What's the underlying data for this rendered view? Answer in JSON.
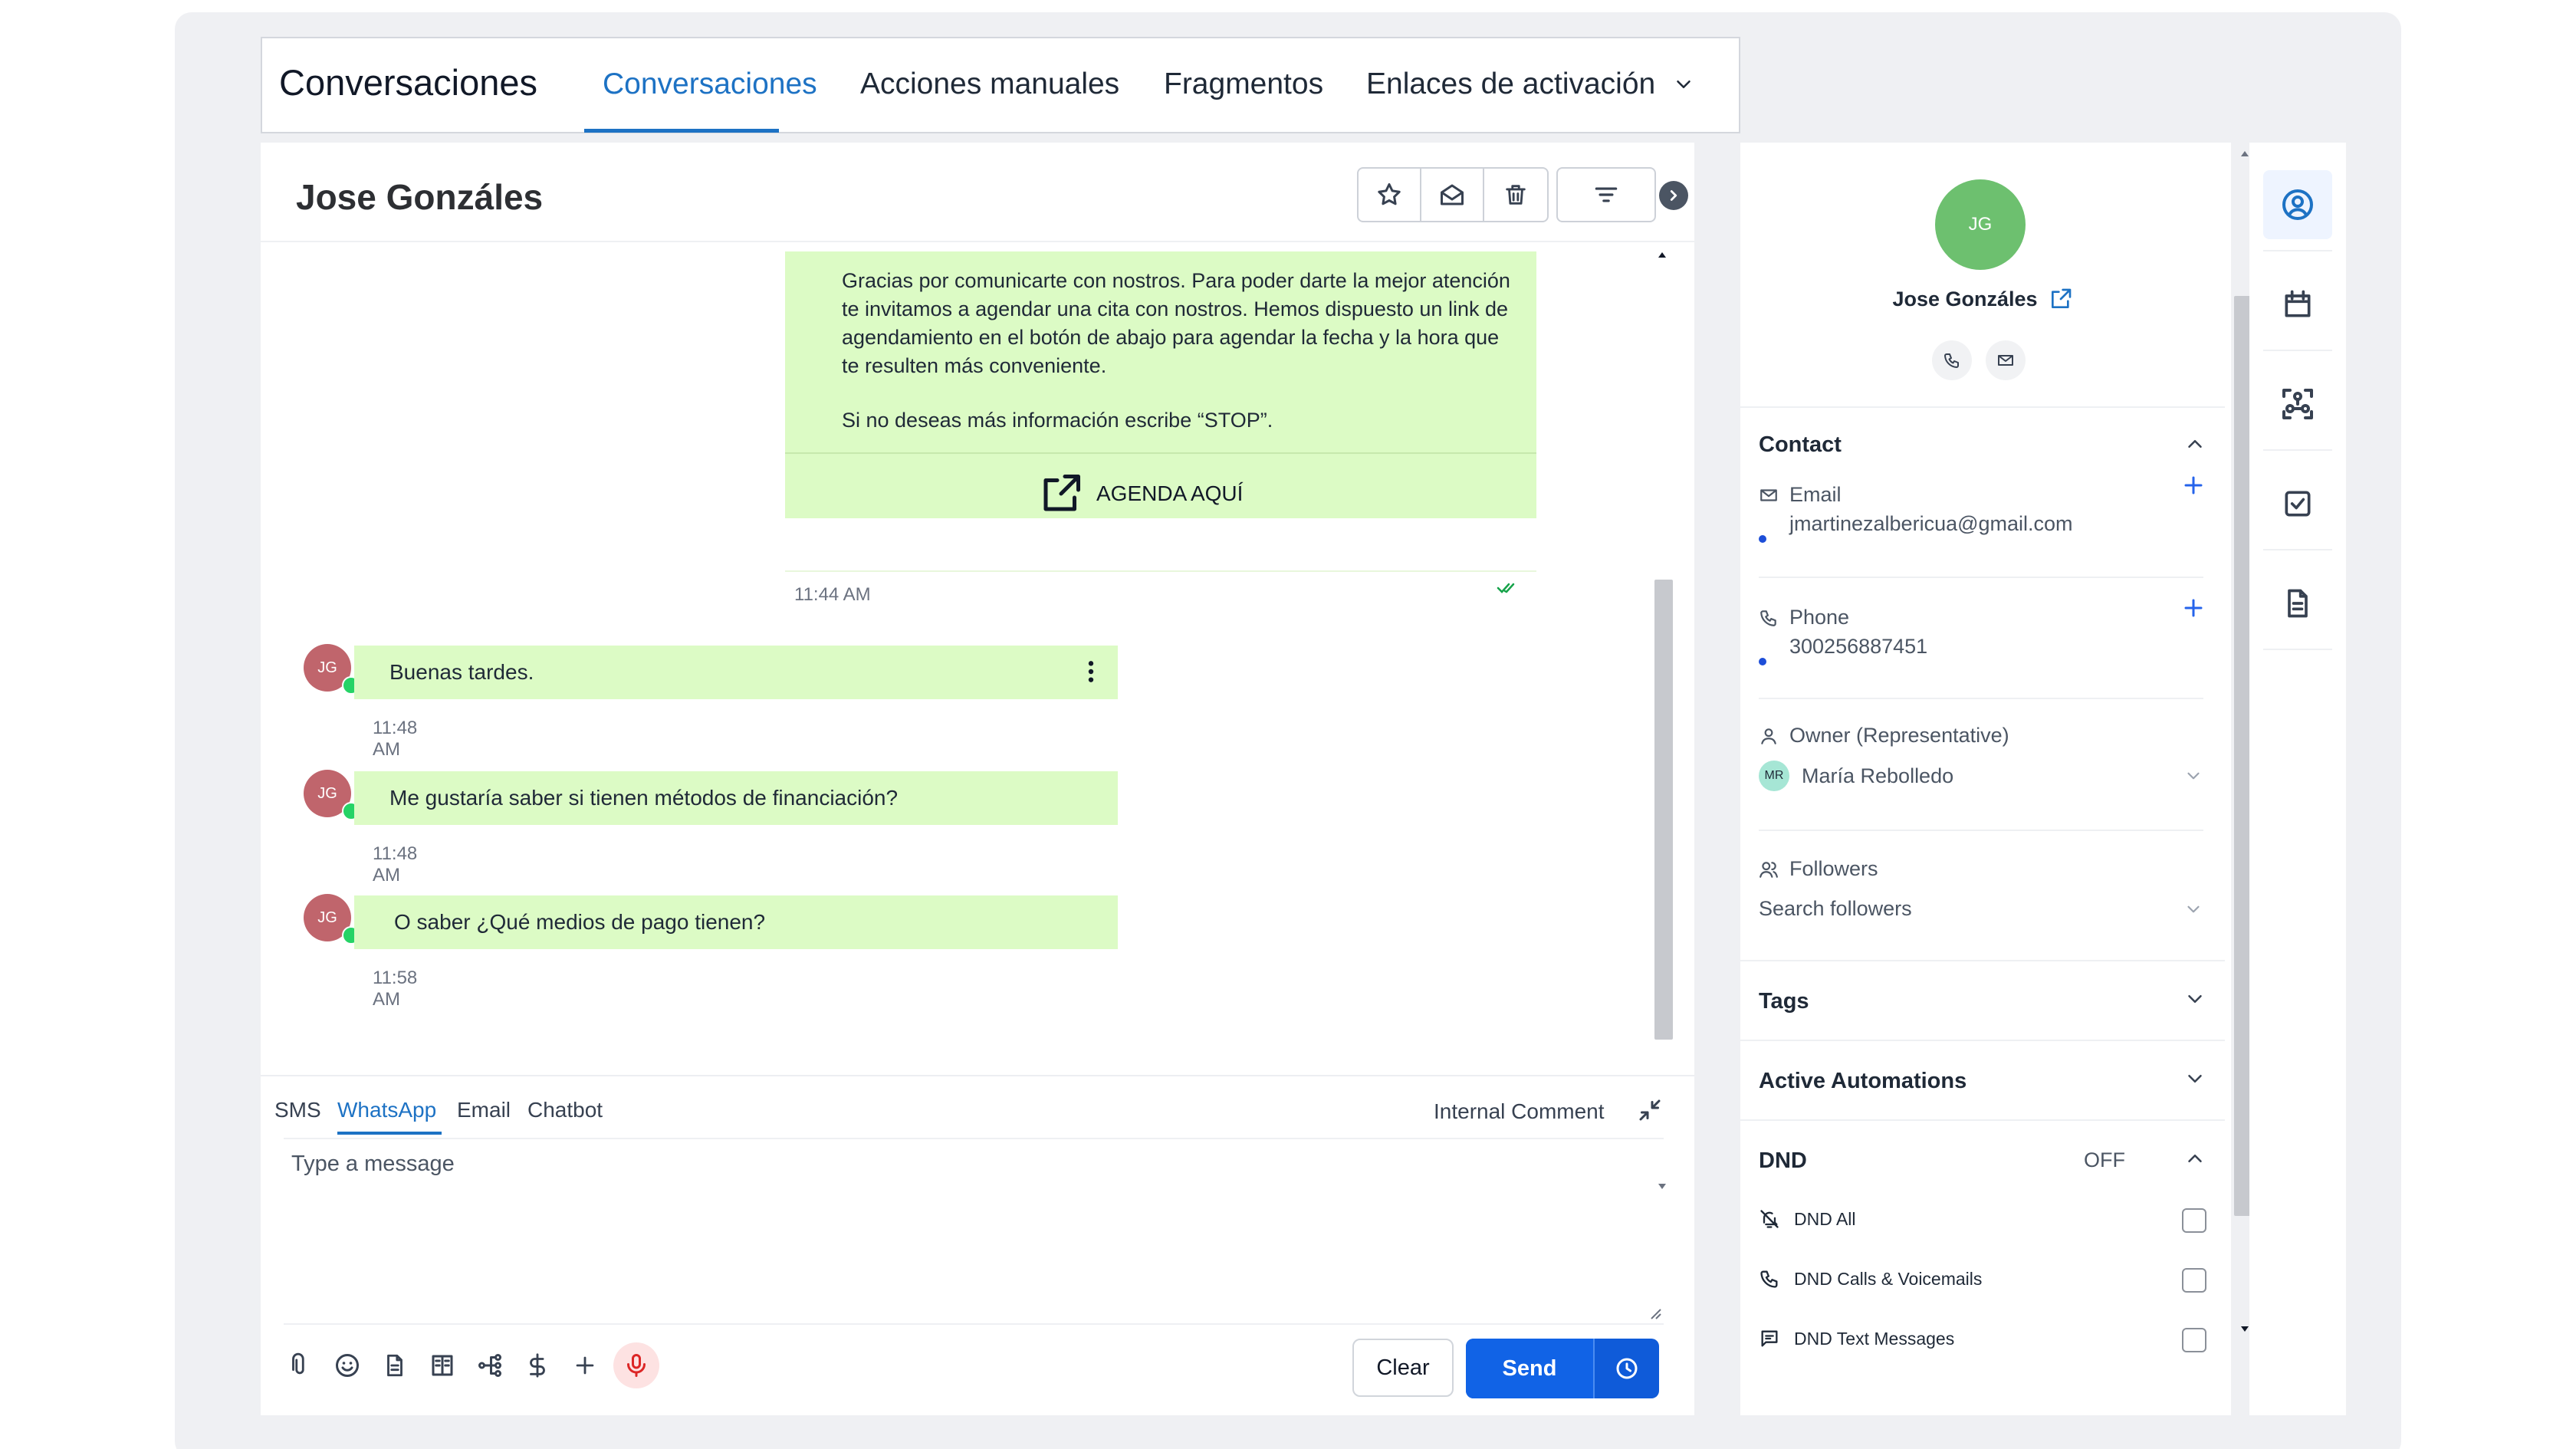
{
  "header": {
    "app_title": "Conversaciones",
    "tabs": [
      {
        "label": "Conversaciones",
        "active": true
      },
      {
        "label": "Acciones manuales"
      },
      {
        "label": "Fragmentos"
      },
      {
        "label": "Enlaces de activación"
      }
    ]
  },
  "conversation": {
    "contact_name": "Jose Gonzáles",
    "outgoing": {
      "paragraph1": "Gracias por comunicarte con nostros. Para poder darte la mejor atención te invitamos a agendar una cita con nostros. Hemos dispuesto un link de agendamiento en el botón de abajo para agendar la fecha y la hora que te resulten más conveniente.",
      "paragraph2": "Si no deseas más información escribe “STOP”.",
      "button_label": "AGENDA AQUÍ",
      "time": "11:44 AM"
    },
    "incoming": [
      {
        "initials": "JG",
        "text": "Buenas tardes.",
        "time": "11:48 AM"
      },
      {
        "initials": "JG",
        "text": "Me gustaría saber si tienen métodos de financiación?",
        "time": "11:48 AM"
      },
      {
        "initials": "JG",
        "text": "O saber ¿Qué medios de pago tienen?",
        "time": "11:58 AM"
      }
    ]
  },
  "composer": {
    "tabs": [
      {
        "label": "SMS"
      },
      {
        "label": "WhatsApp",
        "active": true
      },
      {
        "label": "Email"
      },
      {
        "label": "Chatbot"
      }
    ],
    "internal_comment": "Internal Comment",
    "placeholder": "Type a message",
    "clear_label": "Clear",
    "send_label": "Send"
  },
  "contact_panel": {
    "initials": "JG",
    "name": "Jose Gonzáles",
    "contact_section": "Contact",
    "email_label": "Email",
    "email_value": "jmartinezalbericua@gmail.com",
    "phone_label": "Phone",
    "phone_value": "300256887451",
    "owner_label": "Owner (Representative)",
    "owner_initials": "MR",
    "owner_value": "María Rebolledo",
    "followers_label": "Followers",
    "followers_placeholder": "Search followers",
    "tags_section": "Tags",
    "automations_section": "Active Automations",
    "dnd_section": "DND",
    "dnd_state": "OFF",
    "dnd_items": [
      {
        "label": "DND All",
        "checked": false
      },
      {
        "label": "DND Calls & Voicemails",
        "checked": false
      },
      {
        "label": "DND Text Messages",
        "checked": false
      }
    ]
  },
  "colors": {
    "accent": "#1d72c4",
    "bubble": "#dcfbc5",
    "send": "#1163e6",
    "avatar_contact": "#6dc06f",
    "avatar_msg": "#c0656c"
  }
}
